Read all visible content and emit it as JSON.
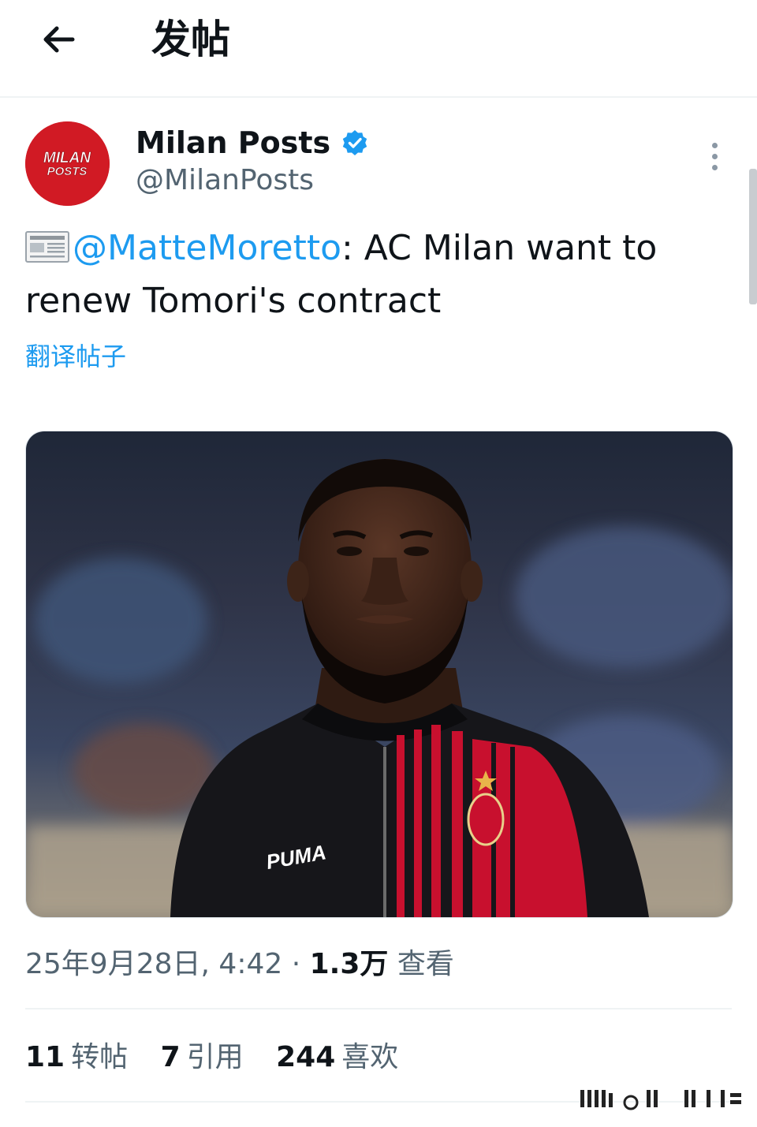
{
  "header": {
    "title": "发帖",
    "back_icon": "arrow-left-icon"
  },
  "author": {
    "name": "Milan Posts",
    "handle": "@MilanPosts",
    "avatar_text": [
      "MILAN",
      "POSTS"
    ],
    "avatar_color": "#d11a24",
    "verified_color": "#1d9bf0"
  },
  "post": {
    "emoji_icon": "newspaper-icon",
    "mention": "@MatteMoretto",
    "text": ": AC Milan want to renew Tomori's contract",
    "translate_label": "翻译帖子"
  },
  "media": {
    "kit_logo_text": "PUMA"
  },
  "meta": {
    "timestamp": "25年9月28日, 4:42",
    "separator": " · ",
    "views_count": "1.3万",
    "views_label": "查看"
  },
  "stats": [
    {
      "count": "11",
      "label": "转帖"
    },
    {
      "count": "7",
      "label": "引用"
    },
    {
      "count": "244",
      "label": "喜欢"
    }
  ],
  "colors": {
    "accent": "#1d9bf0",
    "secondary_text": "#536471",
    "divider": "#eff3f4"
  }
}
